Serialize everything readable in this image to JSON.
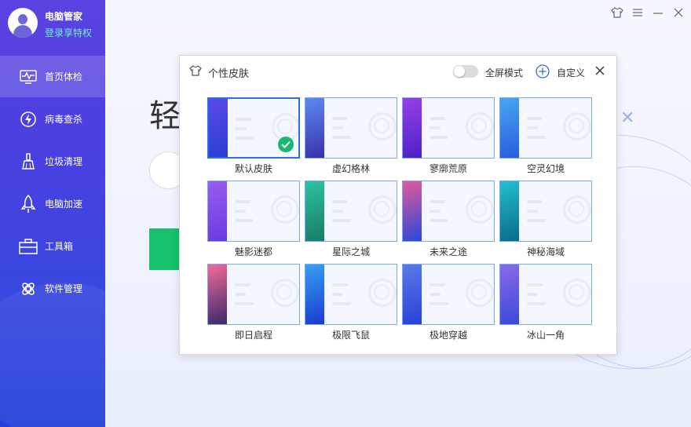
{
  "app": {
    "name": "电脑管家",
    "login_label": "登录享特权"
  },
  "sidebar": {
    "items": [
      {
        "label": "首页体检",
        "icon": "monitor-pulse-icon",
        "active": true
      },
      {
        "label": "病毒查杀",
        "icon": "lightning-shield-icon",
        "active": false
      },
      {
        "label": "垃圾清理",
        "icon": "broom-icon",
        "active": false
      },
      {
        "label": "电脑加速",
        "icon": "rocket-icon",
        "active": false
      },
      {
        "label": "工具箱",
        "icon": "toolbox-icon",
        "active": false
      },
      {
        "label": "软件管理",
        "icon": "app-manager-icon",
        "active": false
      }
    ]
  },
  "main": {
    "headline_char": "轻"
  },
  "window_controls": [
    "skin-icon",
    "menu-icon",
    "minimize-icon",
    "close-icon"
  ],
  "skin_dialog": {
    "title": "个性皮肤",
    "fullscreen_label": "全屏模式",
    "fullscreen_on": false,
    "custom_label": "自定义",
    "skins": [
      {
        "name": "默认皮肤",
        "selected": true,
        "colors": [
          "#2a3fd0",
          "#5a4ae6"
        ]
      },
      {
        "name": "虚幻格林",
        "selected": false,
        "colors": [
          "#3a2fa8",
          "#5b8af0"
        ]
      },
      {
        "name": "寥廓荒原",
        "selected": false,
        "colors": [
          "#4a22c8",
          "#9a3ee8"
        ]
      },
      {
        "name": "空灵幻境",
        "selected": false,
        "colors": [
          "#2a5ae0",
          "#46a8f0"
        ]
      },
      {
        "name": "魅影迷都",
        "selected": false,
        "colors": [
          "#6a3ae0",
          "#9a5cf0"
        ]
      },
      {
        "name": "星际之城",
        "selected": false,
        "colors": [
          "#1a7a6a",
          "#2ac4a0"
        ]
      },
      {
        "name": "未来之途",
        "selected": false,
        "colors": [
          "#2a48d8",
          "#e05a9a"
        ]
      },
      {
        "name": "神秘海域",
        "selected": false,
        "colors": [
          "#0a6a8a",
          "#22c0d0"
        ]
      },
      {
        "name": "即日启程",
        "selected": false,
        "colors": [
          "#3a2a6a",
          "#f06a9a"
        ]
      },
      {
        "name": "极限飞鼠",
        "selected": false,
        "colors": [
          "#1a3ad0",
          "#36a0f0"
        ]
      },
      {
        "name": "极地穿越",
        "selected": false,
        "colors": [
          "#2a40d8",
          "#5a7ae8"
        ]
      },
      {
        "name": "冰山一角",
        "selected": false,
        "colors": [
          "#3a4ad8",
          "#8a6ae8"
        ]
      }
    ]
  }
}
